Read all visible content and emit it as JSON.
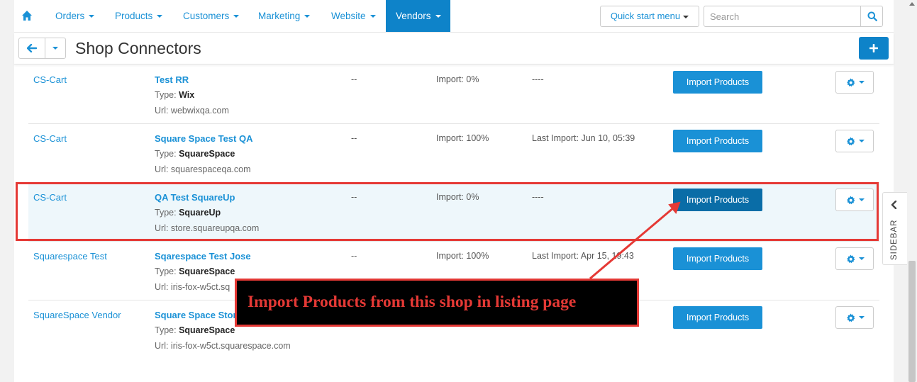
{
  "nav": {
    "items": [
      {
        "label": "Orders"
      },
      {
        "label": "Products"
      },
      {
        "label": "Customers"
      },
      {
        "label": "Marketing"
      },
      {
        "label": "Website"
      },
      {
        "label": "Vendors"
      }
    ],
    "active": "Vendors",
    "quick_start_label": "Quick start menu",
    "search_placeholder": "Search",
    "home_icon": "home-icon",
    "search_icon": "search-icon"
  },
  "title_bar": {
    "title": "Shop Connectors",
    "back_icon": "arrow-left-icon",
    "add_icon": "plus-icon"
  },
  "rows": [
    {
      "vendor": "CS-Cart",
      "name": "Test RR",
      "type_label": "Type:",
      "type": "Wix",
      "url": "Url: webwixqa.com",
      "dash": "--",
      "import": "Import: 0%",
      "last_import": "----",
      "button": "Import Products"
    },
    {
      "vendor": "CS-Cart",
      "name": "Square Space Test QA",
      "type_label": "Type:",
      "type": "SquareSpace",
      "url": "Url: squarespaceqa.com",
      "dash": "--",
      "import": "Import: 100%",
      "last_import": "Last Import: Jun 10, 05:39",
      "button": "Import Products"
    },
    {
      "vendor": "CS-Cart",
      "name": "QA Test SquareUp",
      "type_label": "Type:",
      "type": "SquareUp",
      "url": "Url: store.squareupqa.com",
      "dash": "--",
      "import": "Import: 0%",
      "last_import": "----",
      "button": "Import Products"
    },
    {
      "vendor": "Squarespace Test",
      "name": "Sqarespace Test Jose",
      "type_label": "Type:",
      "type": "SquareSpace",
      "url": "Url: iris-fox-w5ct.sq",
      "dash": "--",
      "import": "Import: 100%",
      "last_import": "Last Import: Apr 15, 19:43",
      "button": "Import Products"
    },
    {
      "vendor": "SquareSpace Vendor",
      "name": "Square Space Stor",
      "type_label": "Type:",
      "type": "SquareSpace",
      "url": "Url: iris-fox-w5ct.squarespace.com",
      "dash": "",
      "import": "",
      "last_import": "",
      "button": "Import Products"
    }
  ],
  "annotation": {
    "callout_text": "Import Products from this shop in listing page",
    "color": "#e53935"
  },
  "sidebar": {
    "label": "SIDEBAR"
  },
  "colors": {
    "link": "#1a91d6",
    "primary": "#0e83c9",
    "highlight_row": "#eef7fb"
  }
}
